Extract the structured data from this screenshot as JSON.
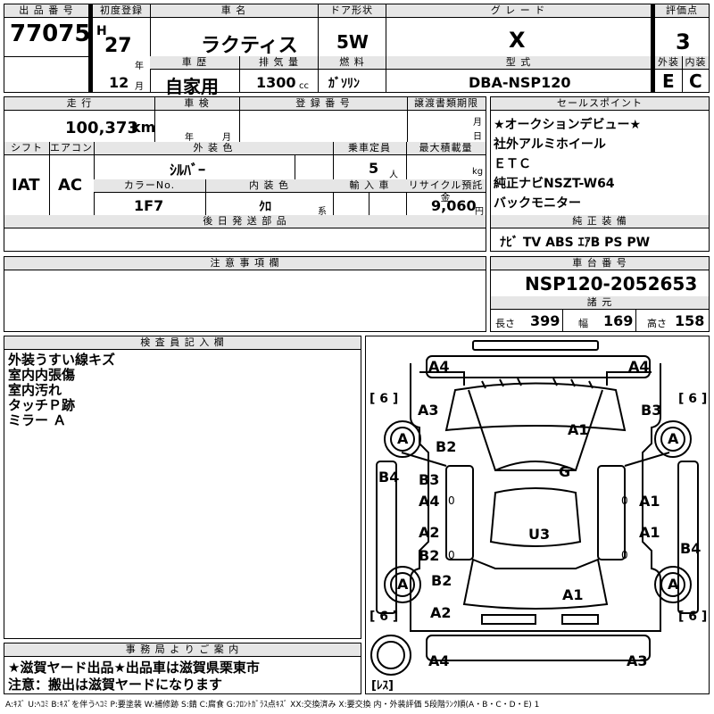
{
  "header": {
    "lot_label": "出 品 番 号",
    "lot_number": "77075",
    "first_reg_label": "初度登録",
    "era": "H",
    "year": "27",
    "year_unit": "年",
    "month": "12",
    "month_unit": "月",
    "name_label": "車 名",
    "car_name": "ラクティス",
    "door_label": "ドア形状",
    "door": "5W",
    "grade_label": "グ レ ー ド",
    "grade": "X",
    "score_label": "評価点",
    "score": "3",
    "history_label": "車 歴",
    "history": "自家用",
    "displacement_label": "排 気 量",
    "displacement": "1300",
    "displacement_unit": "cc",
    "fuel_label": "燃 料",
    "fuel": "ｶﾞｿﾘﾝ",
    "model_label": "型 式",
    "model": "DBA-NSP120",
    "exterior_label": "外装",
    "exterior": "E",
    "interior_label": "内装",
    "interior": "C"
  },
  "row2": {
    "mileage_label": "走 行",
    "mileage": "100,373",
    "mileage_unit": "km",
    "inspection_label": "車 検",
    "inspection_year_unit": "年",
    "inspection_month_unit": "月",
    "reg_label": "登 録 番 号",
    "transfer_label": "譲渡書類期限",
    "transfer_month_unit": "月",
    "transfer_day_unit": "日",
    "shift_label": "シフト",
    "shift": "IAT",
    "ac_label": "エアコン",
    "ac": "AC",
    "color_label": "外 装 色",
    "color": "ｼﾙﾊﾞｰ",
    "capacity_label": "乗車定員",
    "capacity": "5",
    "capacity_unit": "人",
    "load_label": "最大積載量",
    "load_unit": "kg",
    "color_no_label": "カラーNo.",
    "color_no": "1F7",
    "int_color_label": "内 装 色",
    "int_color": "ｸﾛ",
    "int_color_unit": "系",
    "import_label": "輸 入 車",
    "recycle_label": "リサイクル預託金",
    "recycle": "9,060",
    "recycle_unit": "円",
    "later_label": "後 日 発 送 部 品"
  },
  "sales_points": {
    "label": "セールスポイント",
    "items": [
      "★オークションデビュー★",
      "社外アルミホイール",
      "ＥＴＣ",
      "純正ナビNSZT-W64",
      "バックモニター"
    ]
  },
  "equipment": {
    "label": "純 正 装 備",
    "value": "ﾅﾋﾞ TV ABS ｴｱB PS PW"
  },
  "notes": {
    "label": "注 意 事 項 欄"
  },
  "chassis": {
    "label": "車 台 番 号",
    "value": "NSP120-2052653",
    "spec_label": "諸 元",
    "length_label": "長さ",
    "length": "399",
    "width_label": "幅",
    "width": "169",
    "height_label": "高さ",
    "height": "158"
  },
  "inspector": {
    "label": "検 査 員 記 入 欄",
    "lines": [
      "外装うすい線キズ",
      "室内内張傷",
      "室内汚れ",
      "タッチＰ跡",
      "ミラー Ａ"
    ]
  },
  "office": {
    "label": "事 務 局 よ り ご 案 内",
    "lines": [
      "★滋賀ヤード出品★出品車は滋賀県栗東市",
      "注意：搬出は滋賀ヤードになります"
    ]
  },
  "diagram": {
    "tire_tl": "[ 6 ]",
    "tire_tr": "[ 6 ]",
    "tire_bl": "[ 6 ]",
    "tire_br": "[ 6 ]",
    "spare": "[ﾚｽ]",
    "wheel": "A",
    "marks": {
      "front_left": "A4",
      "front_right": "A4",
      "a3": "A3",
      "b3_top": "B3",
      "b2_left": "B2",
      "a1_hood": "A1",
      "b4_left": "B4",
      "g_glass": "G",
      "b3_door": "B3",
      "a4_door": "A4",
      "zero1": "0",
      "a1_door_r": "A1",
      "zero2": "0",
      "a2_door": "A2",
      "b2_door": "B2",
      "zero3": "0",
      "u3_roof": "U3",
      "a1_door_r2": "A1",
      "zero4": "0",
      "b4_right": "B4",
      "b2_rear": "B2",
      "a1_trunk": "A1",
      "a2_rear": "A2",
      "rear_left": "A4",
      "rear_right": "A3"
    }
  },
  "legend": "A:ｷｽﾞ U:ﾍｺﾐ B:ｷｽﾞを伴うﾍｺﾐ P:要塗装 W:補修跡 S:錆 C:腐食 G:ﾌﾛﾝﾄｶﾞﾗｽ点ｷｽﾞ XX:交換済み X:要交換 内・外装評価 5段階ﾗﾝｸ順(A・B・C・D・E) 1"
}
